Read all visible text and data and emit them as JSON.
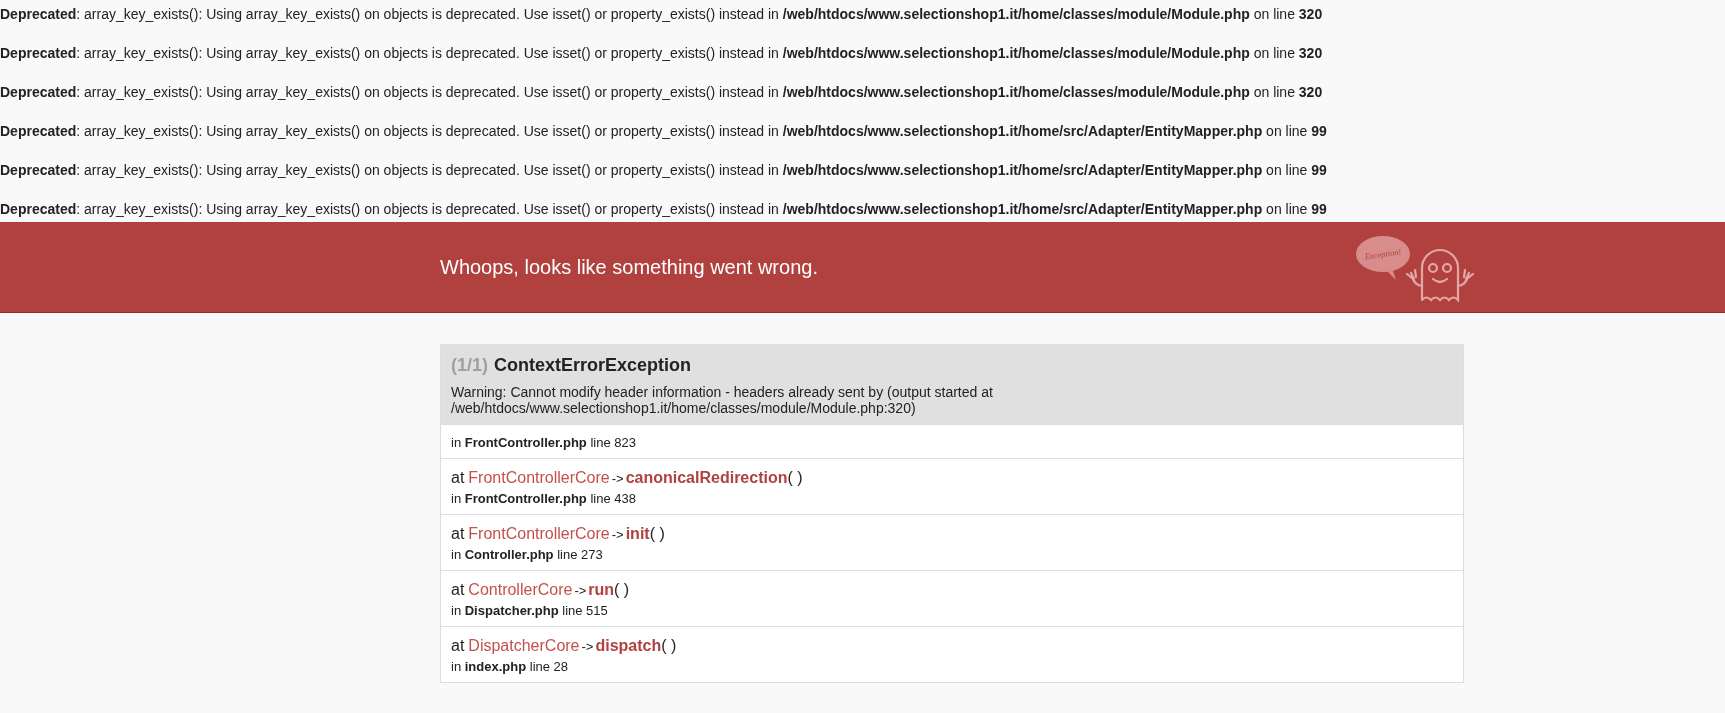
{
  "warnings": [
    "**Deprecated**: array_key_exists(): Using array_key_exists() on objects is deprecated. Use isset() or property_exists() instead in **/web/htdocs/www.selectionshop1.it/home/classes/module/Module.php** on line **320**",
    "**Deprecated**: array_key_exists(): Using array_key_exists() on objects is deprecated. Use isset() or property_exists() instead in **/web/htdocs/www.selectionshop1.it/home/classes/module/Module.php** on line **320**",
    "**Deprecated**: array_key_exists(): Using array_key_exists() on objects is deprecated. Use isset() or property_exists() instead in **/web/htdocs/www.selectionshop1.it/home/classes/module/Module.php** on line **320**",
    "**Deprecated**: array_key_exists(): Using array_key_exists() on objects is deprecated. Use isset() or property_exists() instead in **/web/htdocs/www.selectionshop1.it/home/src/Adapter/EntityMapper.php** on line **99**",
    "**Deprecated**: array_key_exists(): Using array_key_exists() on objects is deprecated. Use isset() or property_exists() instead in **/web/htdocs/www.selectionshop1.it/home/src/Adapter/EntityMapper.php** on line **99**",
    "**Deprecated**: array_key_exists(): Using array_key_exists() on objects is deprecated. Use isset() or property_exists() instead in **/web/htdocs/www.selectionshop1.it/home/src/Adapter/EntityMapper.php** on line **99**"
  ],
  "banner": {
    "title": "Whoops, looks like something went wrong.",
    "logo_bubble_text": "Exception!"
  },
  "exception": {
    "count": "(1/1)",
    "name": "ContextErrorException",
    "message": "Warning: Cannot modify header information - headers already sent by (output started at /web/htdocs/www.selectionshop1.it/home/classes/module/Module.php:320)",
    "trace": [
      {
        "location": "in **FrontController.php** line 823"
      },
      {
        "prefix": "at",
        "class": "FrontControllerCore",
        "arrow": "->",
        "method": "canonicalRedirection",
        "args": "( )",
        "location": "in **FrontController.php** line 438"
      },
      {
        "prefix": "at",
        "class": "FrontControllerCore",
        "arrow": "->",
        "method": "init",
        "args": "( )",
        "location": "in **Controller.php** line 273"
      },
      {
        "prefix": "at",
        "class": "ControllerCore",
        "arrow": "->",
        "method": "run",
        "args": "( )",
        "location": "in **Dispatcher.php** line 515"
      },
      {
        "prefix": "at",
        "class": "DispatcherCore",
        "arrow": "->",
        "method": "dispatch",
        "args": "( )",
        "location": "in **index.php** line 28"
      }
    ]
  }
}
